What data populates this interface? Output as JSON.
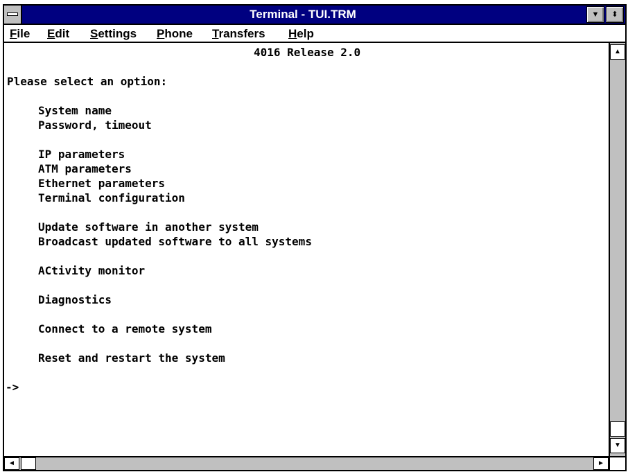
{
  "window": {
    "title": "Terminal - TUI.TRM",
    "icons": {
      "system_menu": "system-menu-icon",
      "minimize": "minimize-arrow-icon",
      "maximize": "maximize-arrows-icon"
    },
    "minimize_glyph": "▼",
    "maximize_glyph": "⬍"
  },
  "menubar": {
    "items": [
      "File",
      "Edit",
      "Settings",
      "Phone",
      "Transfers",
      "Help"
    ]
  },
  "terminal": {
    "header": "4016 Release 2.0",
    "prompt_text": "Please select an option:",
    "options": [
      "System name",
      "Password, timeout",
      "IP parameters",
      "ATM parameters",
      "Ethernet parameters",
      "Terminal configuration",
      "Update software in another system",
      "Broadcast updated software to all systems",
      "ACtivity monitor",
      "Diagnostics",
      "Connect to a remote system",
      "Reset and restart the system"
    ],
    "cursor_prompt": "->"
  },
  "scrollbars": {
    "up_glyph": "▲",
    "down_glyph": "▼",
    "left_glyph": "◄",
    "right_glyph": "►"
  },
  "colors": {
    "title_bar": "#000080",
    "scrollbar_track": "#c0c0c0",
    "text": "#000000",
    "background": "#ffffff"
  }
}
